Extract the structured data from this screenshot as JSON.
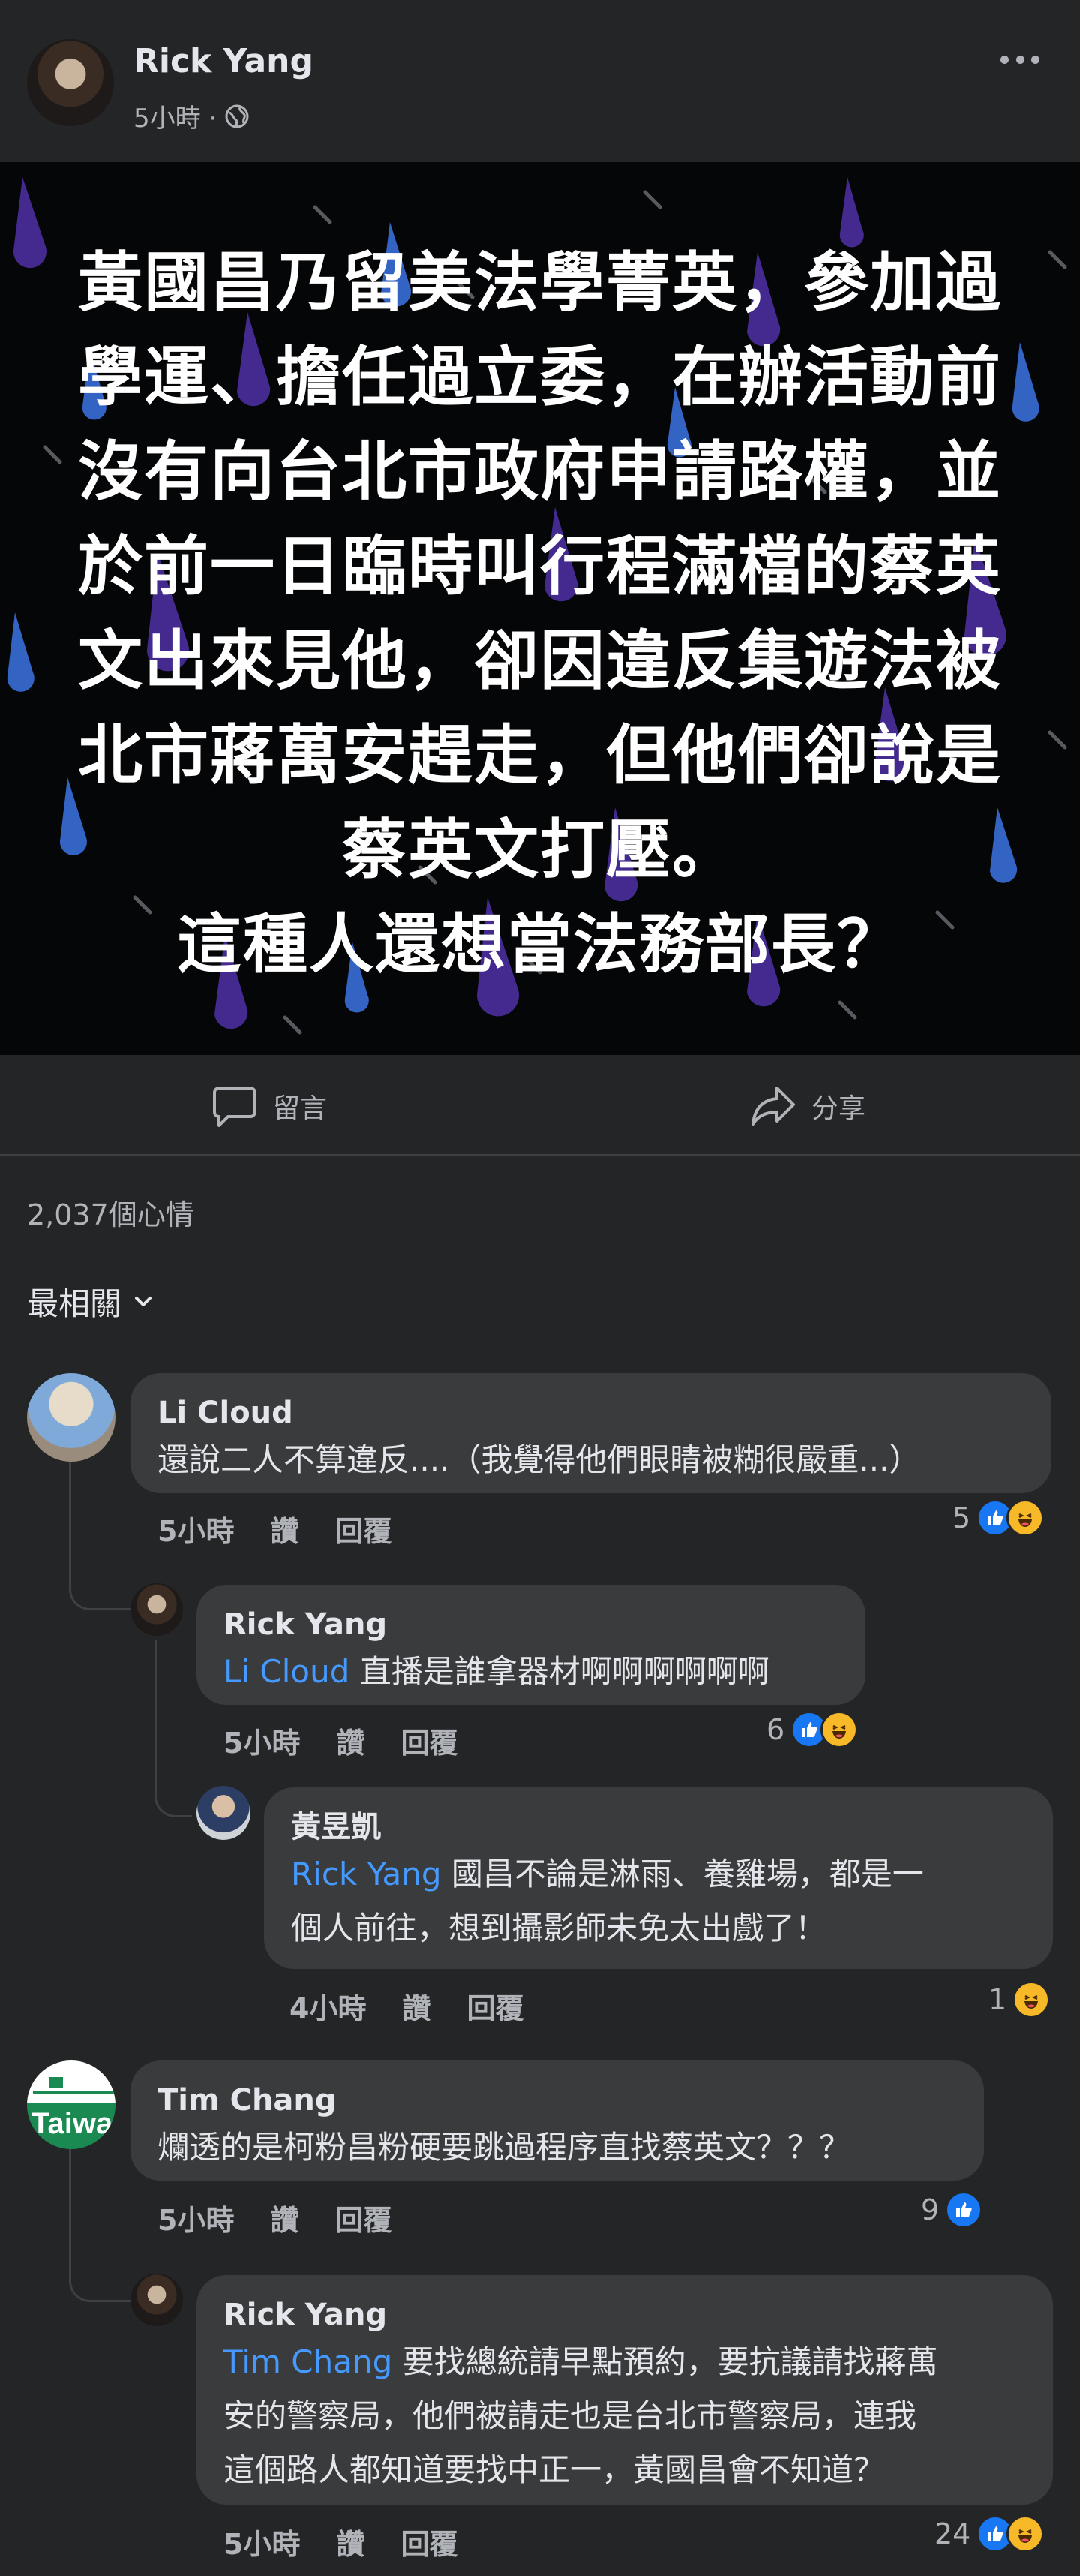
{
  "post": {
    "author": "Rick Yang",
    "time": "5小時 ·",
    "image_text": "黃國昌乃留美法學菁英，參加過\n學運、擔任過立委，在辦活動前\n沒有向台北市政府申請路權，並\n於前一日臨時叫行程滿檔的蔡英\n文出來見他，卻因違反集遊法被\n北市蔣萬安趕走，但他們卻說是\n蔡英文打壓。\n這種人還想當法務部長？"
  },
  "actions": {
    "comment": "留言",
    "share": "分享"
  },
  "reactions_summary": "2,037個心情",
  "sort_label": "最相關",
  "comments": [
    {
      "name": "Li Cloud",
      "mention": "",
      "text": "還說二人不算違反....（我覺得他們眼睛被糊很嚴重...）",
      "time": "5小時",
      "like": "讚",
      "reply": "回覆",
      "count": "5"
    },
    {
      "name": "Rick Yang",
      "mention": "Li Cloud",
      "text": " 直播是誰拿器材啊啊啊啊啊啊",
      "time": "5小時",
      "like": "讚",
      "reply": "回覆",
      "count": "6"
    },
    {
      "name": "黃昱凱",
      "mention": "Rick Yang",
      "text": " 國昌不論是淋雨、養雞場，都是一\n個人前往，想到攝影師未免太出戲了！",
      "time": "4小時",
      "like": "讚",
      "reply": "回覆",
      "count": "1"
    },
    {
      "name": "Tim Chang",
      "mention": "",
      "text": "爛透的是柯粉昌粉硬要跳過程序直找蔡英文？？？",
      "time": "5小時",
      "like": "讚",
      "reply": "回覆",
      "count": "9",
      "avatar_text": "Taiwa"
    },
    {
      "name": "Rick Yang",
      "mention": "Tim Chang",
      "text": " 要找總統請早點預約，要抗議請找蔣萬\n安的警察局，他們被請走也是台北市警察局，連我\n這個路人都知道要找中正一，黃國昌會不知道？",
      "time": "5小時",
      "like": "讚",
      "reply": "回覆",
      "count": "24"
    }
  ]
}
